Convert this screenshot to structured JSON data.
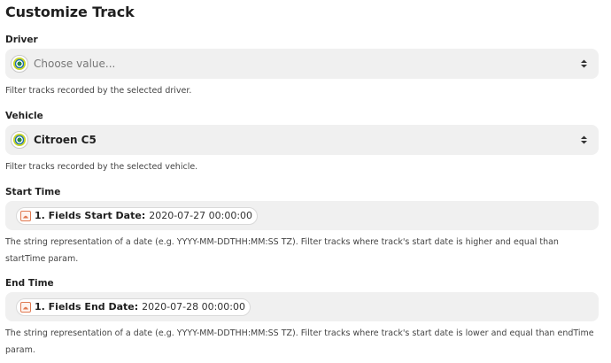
{
  "title": "Customize Track",
  "driver": {
    "label": "Driver",
    "placeholder": "Choose value...",
    "help": "Filter tracks recorded by the selected driver."
  },
  "vehicle": {
    "label": "Vehicle",
    "value": "Citroen C5",
    "help": "Filter tracks recorded by the selected vehicle."
  },
  "start_time": {
    "label": "Start Time",
    "pill_label": "1. Fields Start Date:",
    "pill_value": "2020-07-27 00:00:00",
    "help_line1": "The string representation of a date (e.g. YYYY-MM-DDTHH:MM:SS TZ). Filter tracks where track's start date is higher and equal than",
    "help_line2": "startTime param."
  },
  "end_time": {
    "label": "End Time",
    "pill_label": "1. Fields End Date:",
    "pill_value": "2020-07-28 00:00:00",
    "help_line1": "The string representation of a date (e.g. YYYY-MM-DDTHH:MM:SS TZ). Filter tracks where track's start date is lower and equal than endTime",
    "help_line2": "param."
  },
  "icons": {
    "app": "app-logo-icon",
    "chevron": "chevron-up-down-icon",
    "step": "step-app-icon"
  },
  "colors": {
    "field_bg": "#f0f0f0",
    "step_accent": "#e07a52"
  }
}
